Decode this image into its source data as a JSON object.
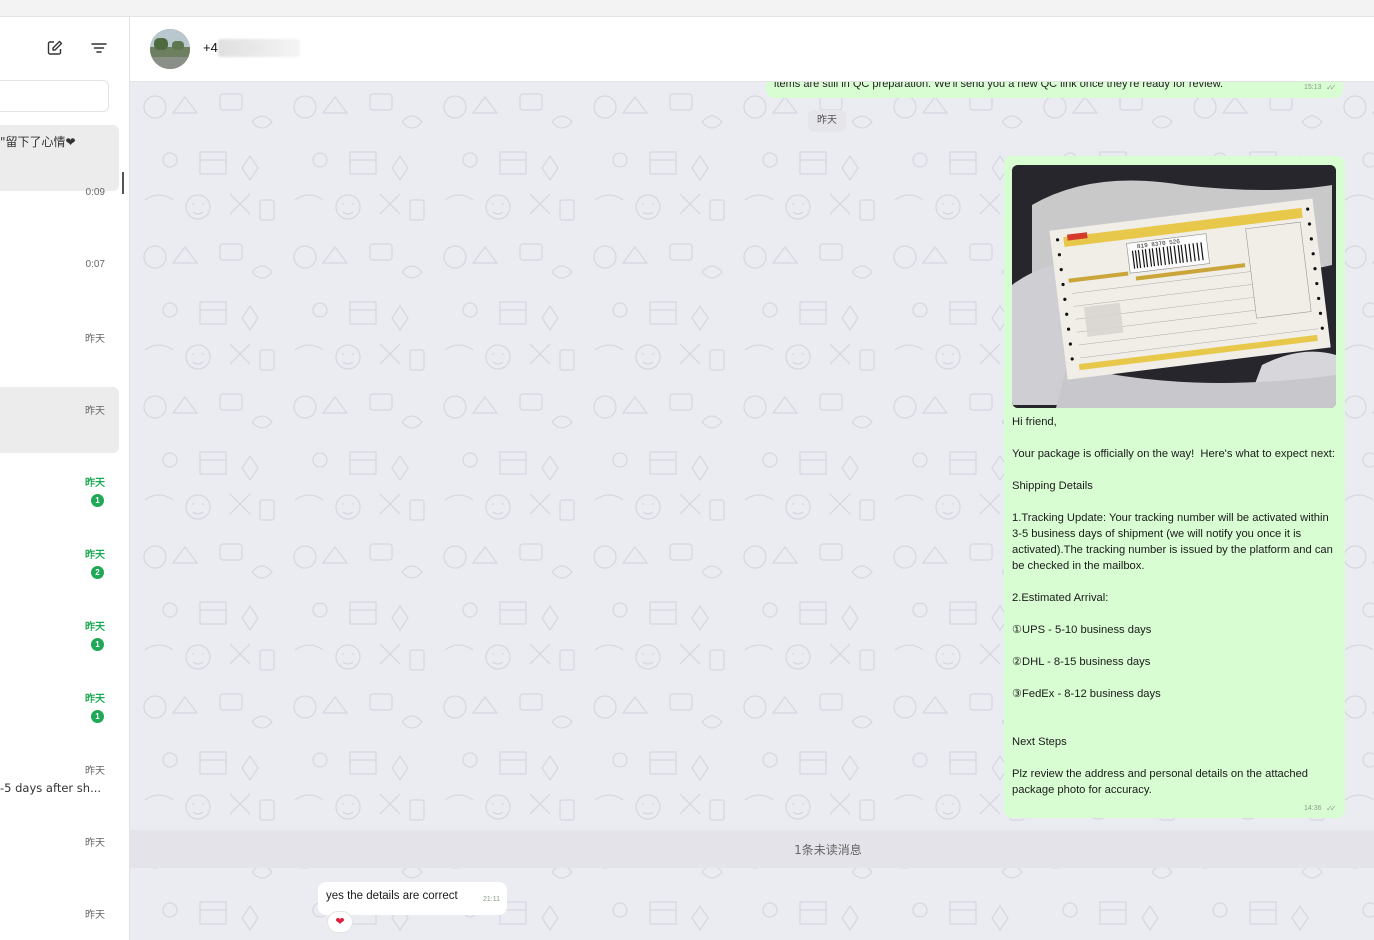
{
  "header": {
    "contact_name": "+4"
  },
  "sidebar": {
    "top_preview": "\"留下了心情❤",
    "items": [
      {
        "time": "0:09"
      },
      {
        "time": "0:07"
      },
      {
        "time": "昨天"
      },
      {
        "time": "昨天"
      },
      {
        "time": "昨天",
        "badge": "1"
      },
      {
        "time": "昨天",
        "badge": "2"
      },
      {
        "time": "昨天",
        "badge": "1"
      },
      {
        "time": "昨天",
        "badge": "1"
      },
      {
        "time": "昨天",
        "preview": "-5 days after sh..."
      },
      {
        "time": "昨天"
      },
      {
        "time": "昨天"
      }
    ]
  },
  "chat": {
    "prev_message": {
      "text": "items are still in QC preparation. We'll send you a new QC link once they're ready for review.",
      "time": "15:13"
    },
    "date_divider": "昨天",
    "outgoing": {
      "text": "Hi friend,\n\nYour package is officially on the way!  Here's what to expect next:\n\nShipping Details\n\n1.Tracking Update: Your tracking number will be activated within 3-5 business days of shipment (we will notify you once it is activated).The tracking number is issued by the platform and can be checked in the mailbox.\n\n2.Estimated Arrival:\n\n①UPS - 5-10 business days\n\n②DHL - 8-15 business days\n\n③FedEx - 8-12 business days\n\n\nNext Steps\n\nPlz review the address and personal details on the attached package photo for accuracy.",
      "time": "14:36",
      "label_tracking": "819 8370 526"
    },
    "unread_divider": "1条未读消息",
    "incoming": {
      "text": "yes the details are correct",
      "time": "21:11",
      "reaction": "❤"
    }
  }
}
